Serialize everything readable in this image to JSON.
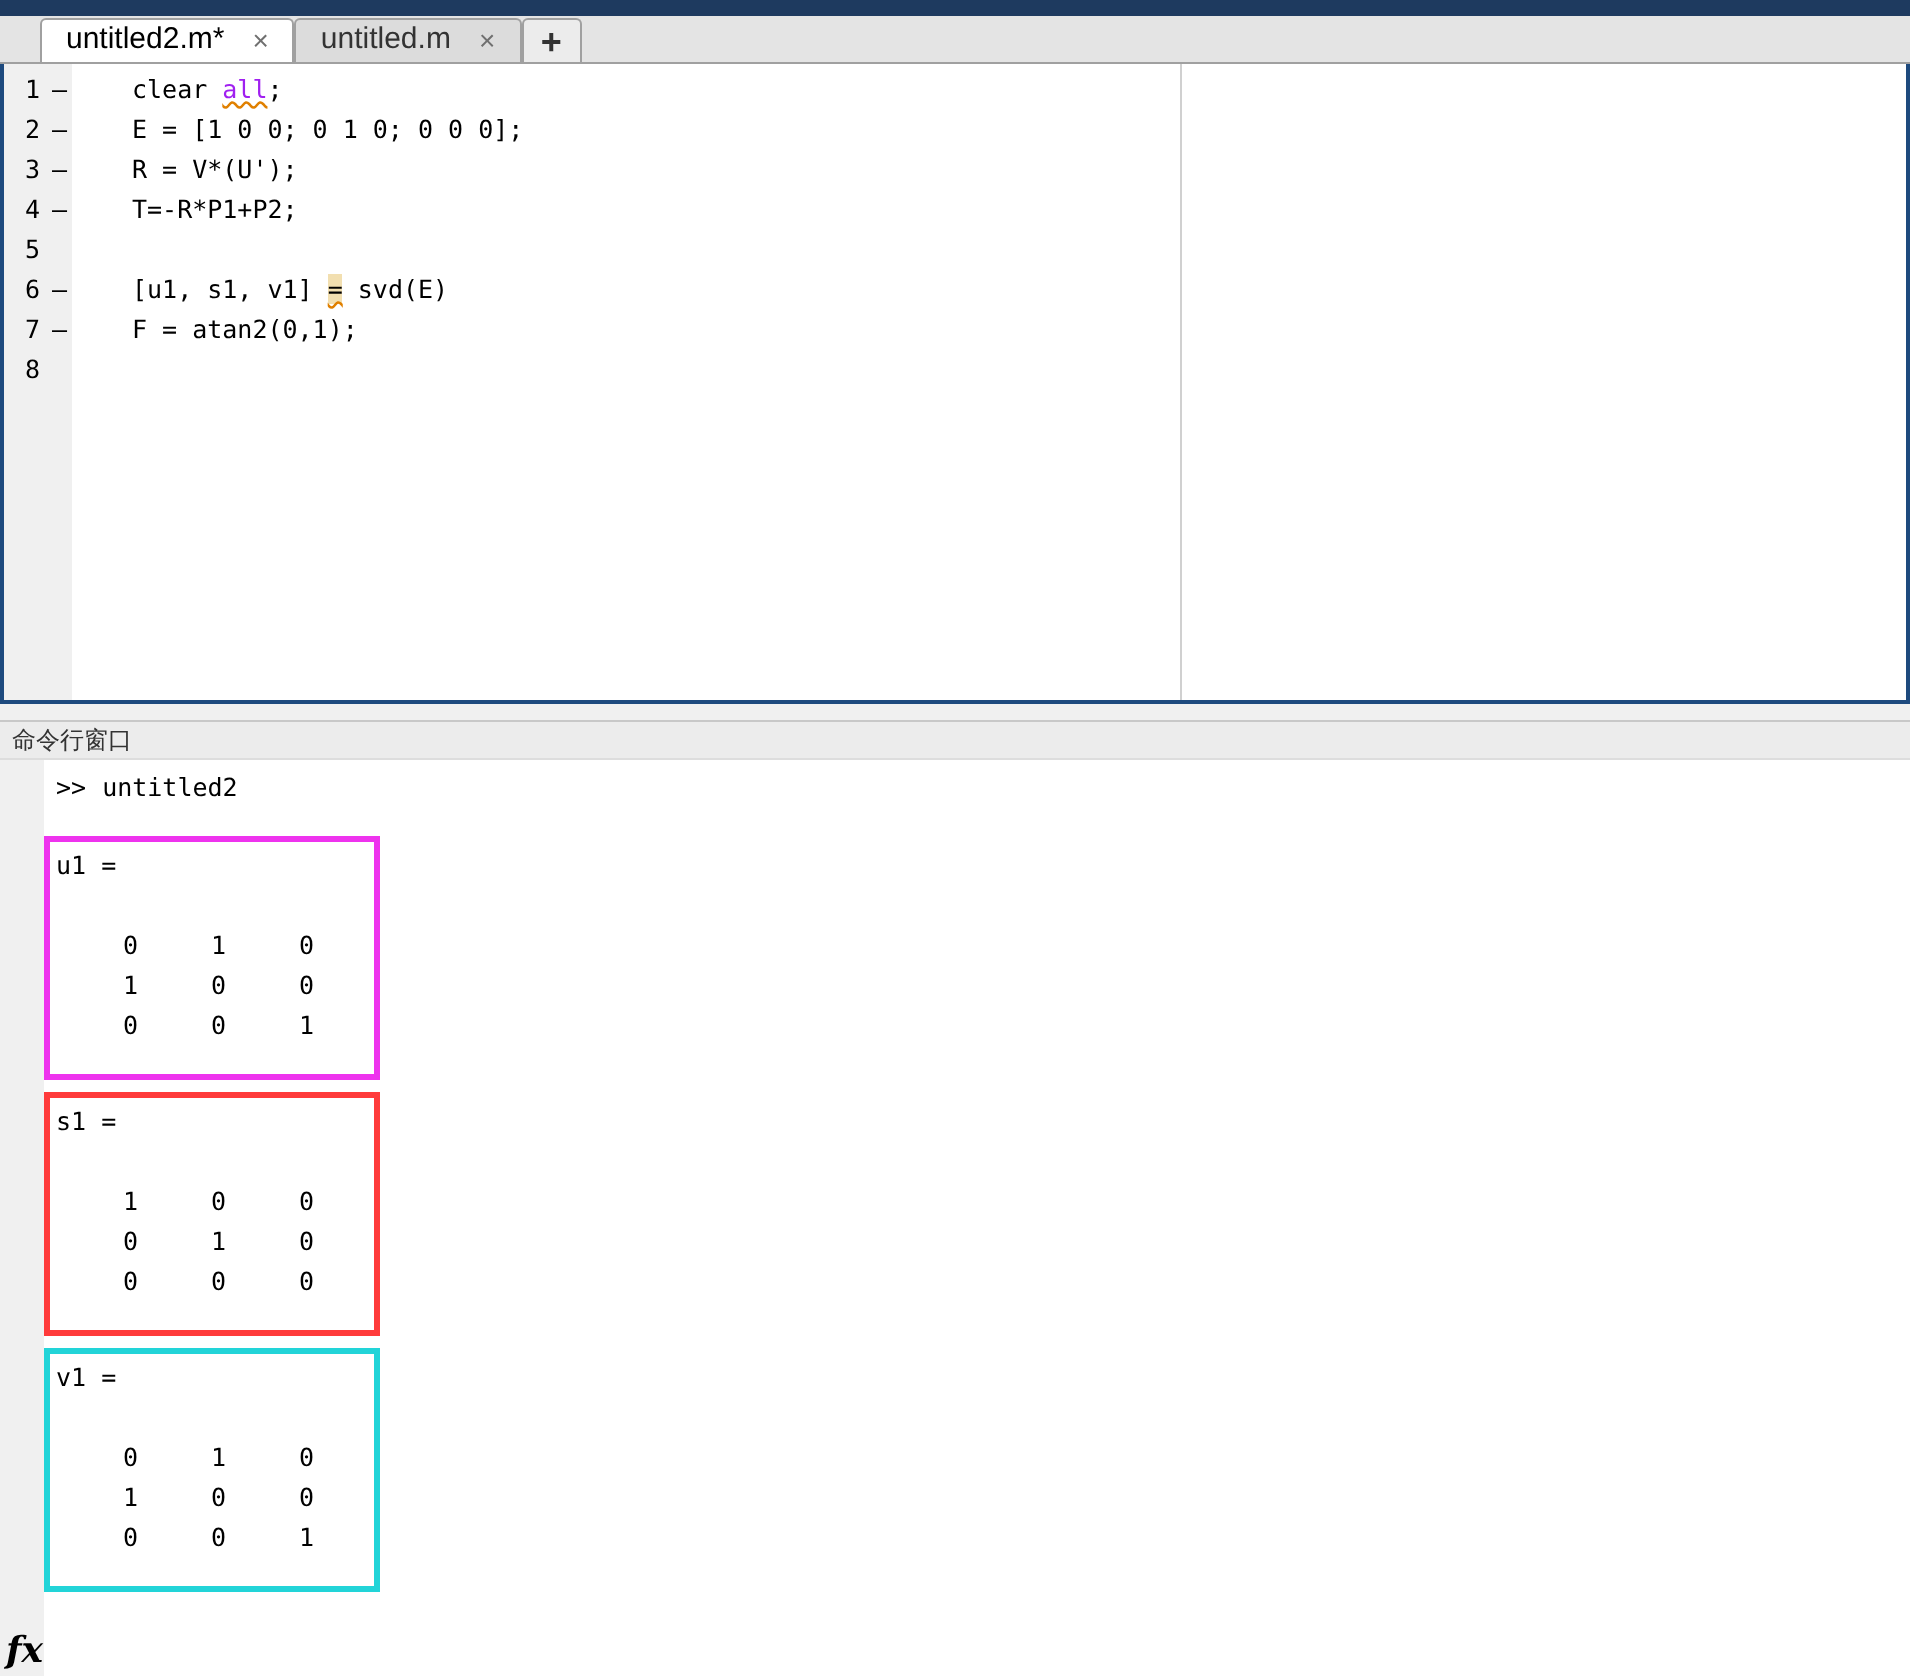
{
  "editor": {
    "tabs": [
      {
        "label": "untitled2.m*",
        "selected": true,
        "close": "×"
      },
      {
        "label": "untitled.m",
        "selected": false,
        "close": "×"
      }
    ],
    "new_tab": "+",
    "lines": [
      {
        "number": "1",
        "marker": "–",
        "segments": [
          {
            "text": "clear ",
            "kind": "plain"
          },
          {
            "text": "all",
            "kind": "keyword"
          },
          {
            "text": ";",
            "kind": "plain"
          }
        ]
      },
      {
        "number": "2",
        "marker": "–",
        "segments": [
          {
            "text": "E = [1 0 0; 0 1 0; 0 0 0];",
            "kind": "plain"
          }
        ]
      },
      {
        "number": "3",
        "marker": "–",
        "segments": [
          {
            "text": "R = V*(U');",
            "kind": "plain"
          }
        ]
      },
      {
        "number": "4",
        "marker": "–",
        "segments": [
          {
            "text": "T=-R*P1+P2;",
            "kind": "plain"
          }
        ]
      },
      {
        "number": "5"
      },
      {
        "number": "6",
        "marker": "–",
        "segments": [
          {
            "text": "[u1, s1, v1] ",
            "kind": "plain"
          },
          {
            "text": "=",
            "kind": "highlight"
          },
          {
            "text": " svd(E)",
            "kind": "plain"
          }
        ]
      },
      {
        "number": "7",
        "marker": "–",
        "segments": [
          {
            "text": "F = atan2(0,1);",
            "kind": "plain"
          }
        ]
      },
      {
        "number": "8"
      }
    ]
  },
  "command_window": {
    "title": "命令行窗口",
    "prompt": ">>",
    "command": "untitled2",
    "results": [
      {
        "name": "u1 =",
        "color": "#ee33ee",
        "rows": [
          [
            "0",
            "1",
            "0"
          ],
          [
            "1",
            "0",
            "0"
          ],
          [
            "0",
            "0",
            "1"
          ]
        ]
      },
      {
        "name": "s1 =",
        "color": "#ff3b3b",
        "rows": [
          [
            "1",
            "0",
            "0"
          ],
          [
            "0",
            "1",
            "0"
          ],
          [
            "0",
            "0",
            "0"
          ]
        ]
      },
      {
        "name": "v1 =",
        "color": "#22d4d8",
        "rows": [
          [
            "0",
            "1",
            "0"
          ],
          [
            "1",
            "0",
            "0"
          ],
          [
            "0",
            "0",
            "1"
          ]
        ]
      }
    ],
    "fx": "fx"
  }
}
